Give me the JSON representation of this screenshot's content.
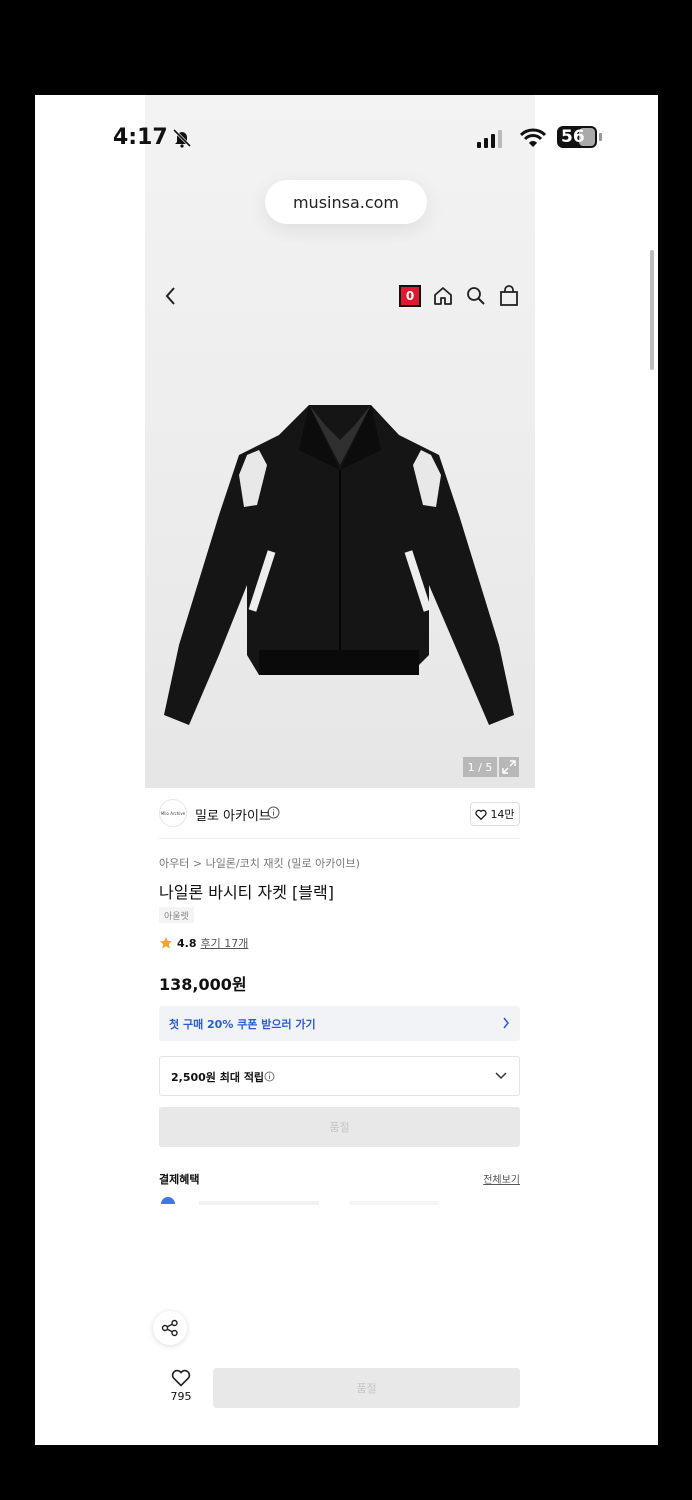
{
  "status_bar": {
    "time": "4:17",
    "battery": "56"
  },
  "browser": {
    "url": "musinsa.com"
  },
  "nav": {
    "cart_count": "0"
  },
  "gallery": {
    "counter": "1 / 5"
  },
  "brand": {
    "logo_text": "Milo Archive",
    "name": "밀로 아카이브",
    "likes": "14만"
  },
  "product": {
    "breadcrumb": "아우터 > 나일론/코치 재킷 (밀로 아카이브)",
    "title": "나일론 바시티 자켓 [블랙]",
    "tag": "아울렛",
    "rating": "4.8",
    "reviews": "후기 17개",
    "price": "138,000원"
  },
  "coupon": {
    "text": "첫 구매 20% 쿠폰 받으러 가기"
  },
  "points": {
    "text": "2,500원 최대 적립"
  },
  "soldout_label": "품절",
  "payment": {
    "title": "결제혜택",
    "see_all": "전체보기"
  },
  "bottom_bar": {
    "fav_count": "795",
    "buy_label": "품절"
  },
  "colors": {
    "accent_red": "#e1182f",
    "coupon_blue": "#2a5bd7"
  }
}
